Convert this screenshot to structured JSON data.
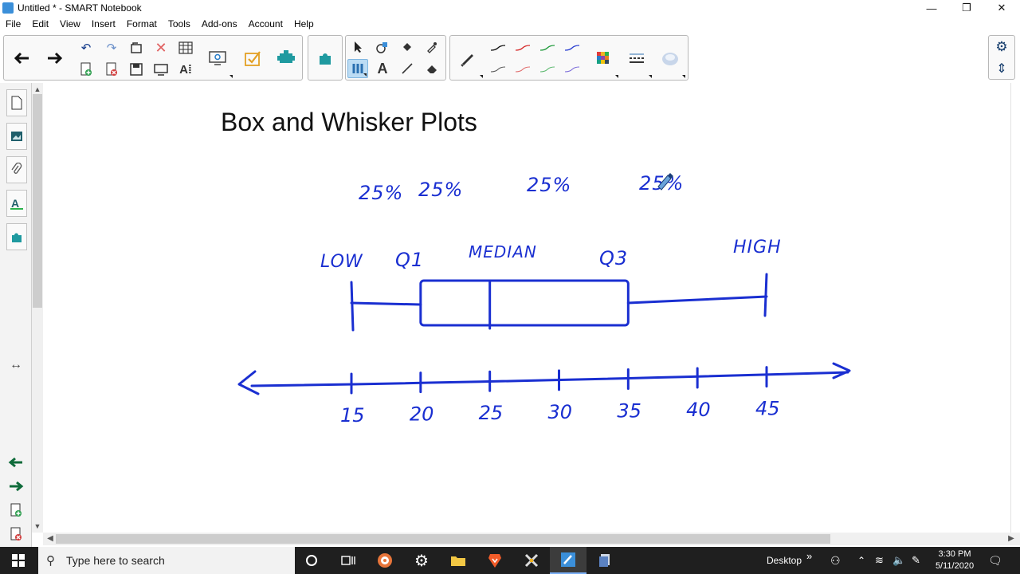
{
  "window": {
    "title": "Untitled * - SMART Notebook",
    "minimize": "—",
    "restore": "❐",
    "close": "✕"
  },
  "menu": [
    "File",
    "Edit",
    "View",
    "Insert",
    "Format",
    "Tools",
    "Add-ons",
    "Account",
    "Help"
  ],
  "toolbar": {
    "back": "🡐",
    "forward": "🡒",
    "undo": "↶",
    "redo": "↷",
    "text_tool": "A"
  },
  "canvas": {
    "title": "Box and Whisker Plots",
    "percent_labels": [
      "25%",
      "25%",
      "25%",
      "25%"
    ],
    "labels": {
      "low": "LOW",
      "q1": "Q1",
      "median": "MEDIAN",
      "q3": "Q3",
      "high": "HIGH"
    }
  },
  "chart_data": {
    "type": "box",
    "title": "Box and Whisker Plots",
    "axis_ticks": [
      15,
      20,
      25,
      30,
      35,
      40,
      45
    ],
    "xlim": [
      15,
      45
    ],
    "summary": {
      "low": 15,
      "q1": 20,
      "median": 25,
      "q3": 35,
      "high": 45
    },
    "quartile_share": [
      "25%",
      "25%",
      "25%",
      "25%"
    ],
    "ink_color": "#1a2fd1"
  },
  "taskbar": {
    "search_placeholder": "Type here to search",
    "desktop_label": "Desktop",
    "chevron": "»",
    "time": "3:30 PM",
    "date": "5/11/2020"
  }
}
